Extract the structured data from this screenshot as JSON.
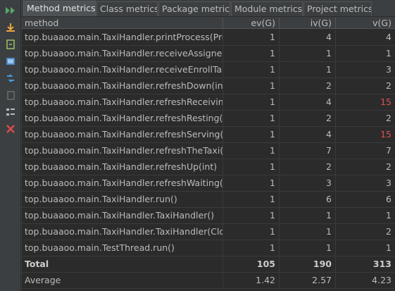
{
  "toolbar": {
    "icons": [
      "run-icon",
      "export-icon",
      "open-file-icon",
      "screenshot-icon",
      "sort-icon",
      "copy-icon",
      "group-icon",
      "close-icon"
    ]
  },
  "tabs": [
    {
      "label": "Method metrics",
      "active": true
    },
    {
      "label": "Class metrics",
      "active": false
    },
    {
      "label": "Package metrics",
      "active": false
    },
    {
      "label": "Module metrics",
      "active": false
    },
    {
      "label": "Project metrics",
      "active": false
    }
  ],
  "table": {
    "columns": [
      "method",
      "ev(G)",
      "iv(G)",
      "v(G)"
    ],
    "rows": [
      {
        "method": "top.buaaoo.main.TaxiHandler.printProcess(Proce",
        "ev": "1",
        "iv": "4",
        "v": "4",
        "alert": false
      },
      {
        "method": "top.buaaoo.main.TaxiHandler.receiveAssignedTa",
        "ev": "1",
        "iv": "1",
        "v": "1",
        "alert": false
      },
      {
        "method": "top.buaaoo.main.TaxiHandler.receiveEnrollTaxis(i",
        "ev": "1",
        "iv": "1",
        "v": "3",
        "alert": false
      },
      {
        "method": "top.buaaoo.main.TaxiHandler.refreshDown(int)",
        "ev": "1",
        "iv": "2",
        "v": "2",
        "alert": false
      },
      {
        "method": "top.buaaoo.main.TaxiHandler.refreshReceiving(int",
        "ev": "1",
        "iv": "4",
        "v": "15",
        "alert": true
      },
      {
        "method": "top.buaaoo.main.TaxiHandler.refreshResting(int)",
        "ev": "1",
        "iv": "2",
        "v": "2",
        "alert": false
      },
      {
        "method": "top.buaaoo.main.TaxiHandler.refreshServing(int)",
        "ev": "1",
        "iv": "4",
        "v": "15",
        "alert": true
      },
      {
        "method": "top.buaaoo.main.TaxiHandler.refreshTheTaxi()",
        "ev": "1",
        "iv": "7",
        "v": "7",
        "alert": false
      },
      {
        "method": "top.buaaoo.main.TaxiHandler.refreshUp(int)",
        "ev": "1",
        "iv": "2",
        "v": "2",
        "alert": false
      },
      {
        "method": "top.buaaoo.main.TaxiHandler.refreshWaiting(int)",
        "ev": "1",
        "iv": "3",
        "v": "3",
        "alert": false
      },
      {
        "method": "top.buaaoo.main.TaxiHandler.run()",
        "ev": "1",
        "iv": "6",
        "v": "6",
        "alert": false
      },
      {
        "method": "top.buaaoo.main.TaxiHandler.TaxiHandler()",
        "ev": "1",
        "iv": "1",
        "v": "1",
        "alert": false
      },
      {
        "method": "top.buaaoo.main.TaxiHandler.TaxiHandler(Clock,",
        "ev": "1",
        "iv": "1",
        "v": "2",
        "alert": false
      },
      {
        "method": "top.buaaoo.main.TestThread.run()",
        "ev": "1",
        "iv": "1",
        "v": "1",
        "alert": false
      }
    ],
    "total": {
      "label": "Total",
      "ev": "105",
      "iv": "190",
      "v": "313"
    },
    "average": {
      "label": "Average",
      "ev": "1.42",
      "iv": "2.57",
      "v": "4.23"
    }
  },
  "colors": {
    "background": "#2b2b2b",
    "panel": "#3c3f41",
    "text": "#bbbbbb",
    "alert": "#e05252",
    "run_icon": "#59a869",
    "close_icon": "#d84b4b"
  }
}
